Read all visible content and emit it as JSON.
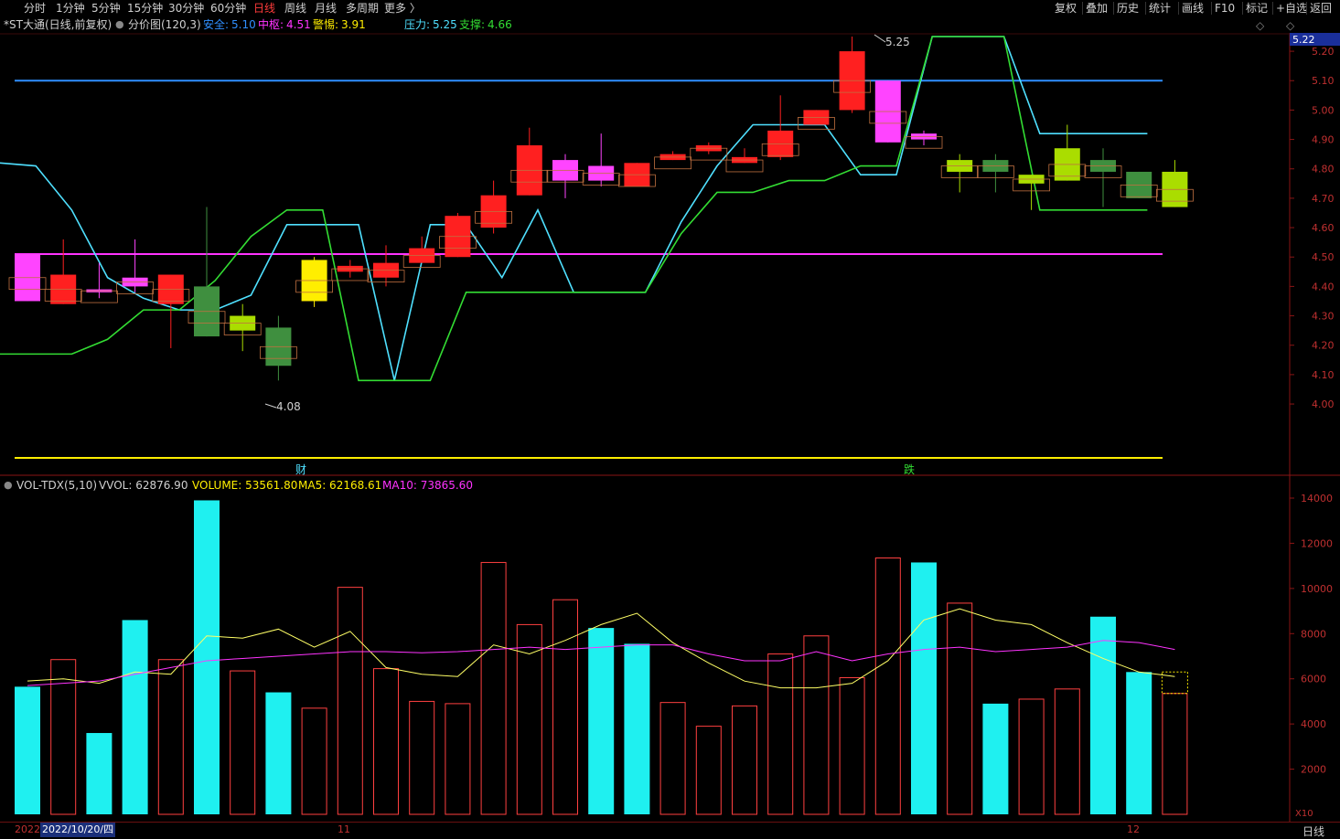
{
  "toolbar": {
    "periods": [
      "分时",
      "1分钟",
      "5分钟",
      "15分钟",
      "30分钟",
      "60分钟",
      "日线",
      "周线",
      "月线",
      "多周期",
      "更多 〉"
    ],
    "active_period": "日线",
    "right_buttons": [
      "复权",
      "叠加",
      "历史",
      "统计",
      "画线",
      "F10",
      "标记",
      "+自选",
      "返回"
    ],
    "right_icons": [
      "◇",
      "◇"
    ]
  },
  "main_header": {
    "stock": "*ST大通(日线,前复权)",
    "indicator": "分价图(120,3)",
    "safe_label": "安全:",
    "safe_value": "5.10",
    "mid_label": "中枢:",
    "mid_value": "4.51",
    "warn_label": "警惕:",
    "warn_value": "3.91",
    "press_label": "压力:",
    "press_value": "5.25",
    "support_label": "支撑:",
    "support_value": "4.66"
  },
  "vol_header": {
    "name": "VOL-TDX(5,10)",
    "vvol": "VVOL: 62876.90",
    "volume": "VOLUME: 53561.80",
    "ma5": "MA5: 62168.61",
    "ma10": "MA10: 73865.60"
  },
  "price_axis": [
    "5.20",
    "5.10",
    "5.00",
    "4.90",
    "4.80",
    "4.70",
    "4.60",
    "4.50",
    "4.40",
    "4.30",
    "4.20",
    "4.10",
    "4.00"
  ],
  "price_tag": "5.22",
  "vol_axis": [
    "14000",
    "12000",
    "10000",
    "8000",
    "6000",
    "4000",
    "2000"
  ],
  "vol_unit": "X10",
  "annotations": {
    "high": "5.25",
    "low": "4.08",
    "marker1": "财",
    "marker2": "跌"
  },
  "bottom": {
    "year": "2022",
    "date": "2022/10/20/四",
    "mark_nov": "11",
    "mark_dec": "12",
    "period": "日线"
  },
  "colors": {
    "up": "#ff2020",
    "down_fill": "#1ff0f0",
    "safe": "#2f8fff",
    "mid": "#ff33ff",
    "warn": "#ffee00",
    "press": "#4fe0ff",
    "support": "#33dd33"
  },
  "chart_data": {
    "type": "candlestick",
    "candles": [
      {
        "o": 4.51,
        "c": 4.35,
        "h": 4.51,
        "l": 4.35,
        "color": "#ff44ff"
      },
      {
        "o": 4.34,
        "c": 4.44,
        "h": 4.56,
        "l": 4.34,
        "color": "#ff2020"
      },
      {
        "o": 4.39,
        "c": 4.38,
        "h": 4.48,
        "l": 4.36,
        "color": "#ff44ff"
      },
      {
        "o": 4.43,
        "c": 4.4,
        "h": 4.56,
        "l": 4.38,
        "color": "#ff44ff"
      },
      {
        "o": 4.34,
        "c": 4.44,
        "h": 4.44,
        "l": 4.19,
        "color": "#ff2020"
      },
      {
        "o": 4.4,
        "c": 4.23,
        "h": 4.67,
        "l": 4.23,
        "color": "#3f8f3f"
      },
      {
        "o": 4.3,
        "c": 4.25,
        "h": 4.34,
        "l": 4.18,
        "color": "#aadd00"
      },
      {
        "o": 4.26,
        "c": 4.13,
        "h": 4.3,
        "l": 4.08,
        "color": "#3f8f3f"
      },
      {
        "o": 4.49,
        "c": 4.35,
        "h": 4.5,
        "l": 4.33,
        "color": "#ffee00"
      },
      {
        "o": 4.45,
        "c": 4.47,
        "h": 4.49,
        "l": 4.43,
        "color": "#ff2020"
      },
      {
        "o": 4.43,
        "c": 4.48,
        "h": 4.54,
        "l": 4.4,
        "color": "#ff2020"
      },
      {
        "o": 4.48,
        "c": 4.53,
        "h": 4.57,
        "l": 4.48,
        "color": "#ff2020"
      },
      {
        "o": 4.5,
        "c": 4.64,
        "h": 4.65,
        "l": 4.5,
        "color": "#ff2020"
      },
      {
        "o": 4.6,
        "c": 4.71,
        "h": 4.76,
        "l": 4.58,
        "color": "#ff2020"
      },
      {
        "o": 4.71,
        "c": 4.88,
        "h": 4.94,
        "l": 4.71,
        "color": "#ff2020"
      },
      {
        "o": 4.83,
        "c": 4.76,
        "h": 4.85,
        "l": 4.7,
        "color": "#ff44ff"
      },
      {
        "o": 4.81,
        "c": 4.76,
        "h": 4.92,
        "l": 4.74,
        "color": "#ff44ff"
      },
      {
        "o": 4.74,
        "c": 4.82,
        "h": 4.82,
        "l": 4.74,
        "color": "#ff2020"
      },
      {
        "o": 4.83,
        "c": 4.85,
        "h": 4.86,
        "l": 4.83,
        "color": "#ff2020"
      },
      {
        "o": 4.86,
        "c": 4.88,
        "h": 4.89,
        "l": 4.85,
        "color": "#ff2020"
      },
      {
        "o": 4.82,
        "c": 4.84,
        "h": 4.87,
        "l": 4.82,
        "color": "#ff2020"
      },
      {
        "o": 4.84,
        "c": 4.93,
        "h": 5.05,
        "l": 4.83,
        "color": "#ff2020"
      },
      {
        "o": 4.95,
        "c": 5.0,
        "h": 5.0,
        "l": 4.95,
        "color": "#ff2020"
      },
      {
        "o": 5.0,
        "c": 5.2,
        "h": 5.25,
        "l": 4.99,
        "color": "#ff2020"
      },
      {
        "o": 5.1,
        "c": 4.89,
        "h": 5.1,
        "l": 4.89,
        "color": "#ff44ff"
      },
      {
        "o": 4.92,
        "c": 4.9,
        "h": 4.93,
        "l": 4.88,
        "color": "#ff44ff"
      },
      {
        "o": 4.83,
        "c": 4.79,
        "h": 4.85,
        "l": 4.72,
        "color": "#aadd00"
      },
      {
        "o": 4.83,
        "c": 4.79,
        "h": 4.85,
        "l": 4.72,
        "color": "#3f8f3f"
      },
      {
        "o": 4.78,
        "c": 4.75,
        "h": 4.78,
        "l": 4.66,
        "color": "#aadd00"
      },
      {
        "o": 4.87,
        "c": 4.76,
        "h": 4.95,
        "l": 4.76,
        "color": "#aadd00"
      },
      {
        "o": 4.83,
        "c": 4.79,
        "h": 4.87,
        "l": 4.67,
        "color": "#3f8f3f"
      },
      {
        "o": 4.79,
        "c": 4.7,
        "h": 4.79,
        "l": 4.7,
        "color": "#3f8f3f"
      },
      {
        "o": 4.79,
        "c": 4.67,
        "h": 4.83,
        "l": 4.67,
        "color": "#aadd00"
      }
    ],
    "volume": [
      5650,
      6850,
      3600,
      8600,
      6850,
      13900,
      6350,
      5400,
      4700,
      10050,
      6450,
      5000,
      4900,
      11150,
      8400,
      9500,
      8250,
      7550,
      4950,
      3900,
      4800,
      7100,
      7900,
      6050,
      11350,
      11150,
      9350,
      4900,
      5100,
      5550,
      8750,
      6300,
      5350
    ],
    "volume_up": [
      false,
      true,
      false,
      false,
      true,
      false,
      true,
      false,
      true,
      true,
      true,
      true,
      true,
      true,
      true,
      true,
      false,
      false,
      true,
      true,
      true,
      true,
      true,
      true,
      true,
      false,
      true,
      false,
      true,
      true,
      false,
      false,
      true
    ],
    "ma5": [
      5900,
      6000,
      5800,
      6300,
      6200,
      7900,
      7800,
      8200,
      7400,
      8100,
      6500,
      6200,
      6100,
      7500,
      7100,
      7700,
      8400,
      8900,
      7600,
      6700,
      5900,
      5600,
      5600,
      5800,
      6800,
      8600,
      9100,
      8600,
      8400,
      7600,
      6900,
      6300,
      6100
    ],
    "ma10": [
      5700,
      5800,
      5900,
      6200,
      6500,
      6800,
      6900,
      7000,
      7100,
      7200,
      7200,
      7150,
      7200,
      7300,
      7400,
      7300,
      7400,
      7500,
      7500,
      7100,
      6800,
      6800,
      7200,
      6800,
      7100,
      7300,
      7400,
      7200,
      7300,
      7400,
      7700,
      7600,
      7300
    ],
    "levels": {
      "safe": 5.1,
      "mid": 4.51,
      "warn": 3.91
    }
  }
}
